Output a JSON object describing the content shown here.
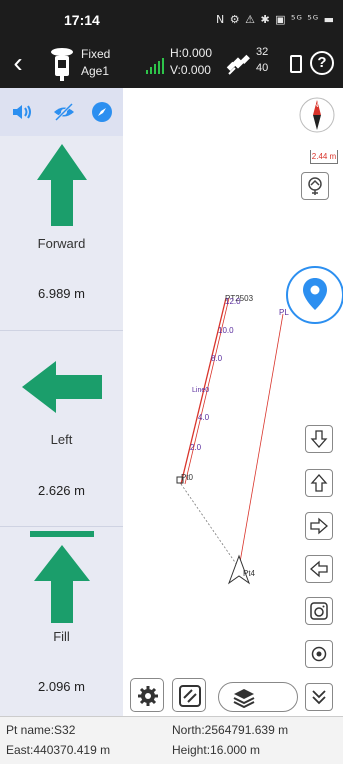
{
  "status_bar": {
    "time": "17:14",
    "icons_text": "N ⚙ ⚠ ✱ ▣ ⁵ᴳ ⁵ᴳ ▬"
  },
  "header": {
    "fix_status": "Fixed",
    "age": "Age1",
    "h_precision": "H:0.000",
    "v_precision": "V:0.000",
    "sat_count_top": "32",
    "sat_count_bottom": "40",
    "help_symbol": "?"
  },
  "guidance": {
    "forward": {
      "label": "Forward",
      "value": "6.989 m"
    },
    "left": {
      "label": "Left",
      "value": "2.626 m"
    },
    "fill": {
      "label": "Fill",
      "value": "2.096 m"
    }
  },
  "map": {
    "scale_label": "2.44 m",
    "point_labels": [
      "PT2503",
      "12.0",
      "10.0",
      "8.0",
      "Line0",
      "4.0",
      "2.0",
      "Pt0",
      "PL",
      "Pt4"
    ]
  },
  "footer": {
    "pt_name": "Pt name:S32",
    "north": "North:2564791.639 m",
    "east": "East:440370.419 m",
    "height": "Height:16.000 m"
  },
  "colors": {
    "arrow": "#1b9e6b",
    "accent": "#2c8ff0",
    "line": "#d9342b"
  }
}
